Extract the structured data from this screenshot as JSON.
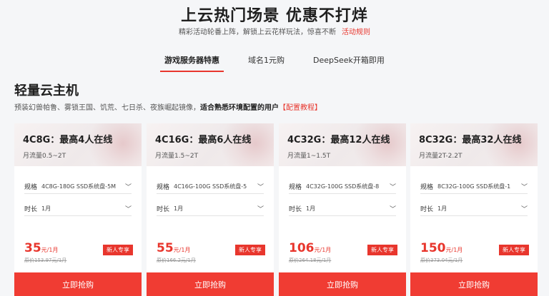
{
  "hero": {
    "title": "上云热门场景 优惠不打烊",
    "subtitle": "精彩活动轮番上阵，解锁上云花样玩法，惊喜不断",
    "rules_link": "活动规则"
  },
  "tabs": [
    {
      "label": "游戏服务器特惠",
      "active": true
    },
    {
      "label": "域名1元购",
      "active": false
    },
    {
      "label": "DeepSeek开箱即用",
      "active": false
    }
  ],
  "section": {
    "title": "轻量云主机",
    "desc_plain": "预装幻兽帕鲁、雾锁王国、饥荒、七日杀、夜族崛起镜像，",
    "desc_bold": "适合熟悉环境配置的用户",
    "tutorial_link": "【配置教程】"
  },
  "labels": {
    "spec": "规格",
    "duration": "时长",
    "buy": "立即抢购",
    "badge": "新人专享",
    "price_unit": "元/1月"
  },
  "cards": [
    {
      "title": "4C8G：最高4人在线",
      "traffic": "月流量0.5~2T",
      "spec": "4C8G-180G SSD系统盘-5M",
      "duration": "1月",
      "price": "35",
      "original": "原价153.97元/1月"
    },
    {
      "title": "4C16G：最高6人在线",
      "traffic": "月流量1.5~2T",
      "spec": "4C16G-100G SSD系统盘-5",
      "duration": "1月",
      "price": "55",
      "original": "原价166.2元/1月"
    },
    {
      "title": "4C32G：最高12人在线",
      "traffic": "月流量1~1.5T",
      "spec": "4C32G-100G SSD系统盘-8",
      "duration": "1月",
      "price": "106",
      "original": "原价264.18元/1月"
    },
    {
      "title": "8C32G：最高32人在线",
      "traffic": "月流量2T-2.2T",
      "spec": "8C32G-100G SSD系统盘-1",
      "duration": "1月",
      "price": "150",
      "original": "原价373.04元/1月"
    }
  ],
  "colors": {
    "accent": "#e8362d",
    "button": "#f03c33",
    "background": "#f5f6f8"
  },
  "icons": {
    "dropdown": "chevron-down-icon"
  }
}
